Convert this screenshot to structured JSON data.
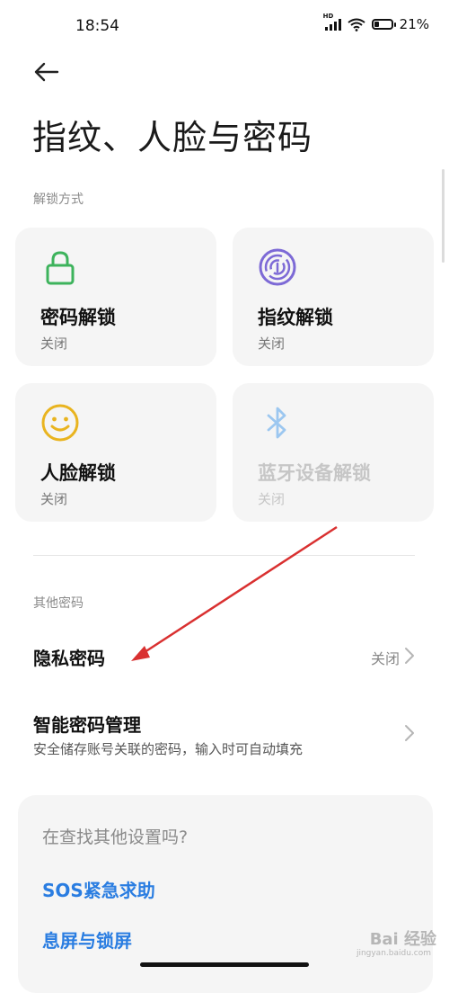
{
  "status_bar": {
    "time": "18:54",
    "network": "HD",
    "battery": "21%"
  },
  "page": {
    "title": "指纹、人脸与密码"
  },
  "unlock_section": {
    "label": "解锁方式",
    "items": [
      {
        "name": "密码解锁",
        "state": "关闭",
        "icon": "lock-icon",
        "color": "#3db35c"
      },
      {
        "name": "指纹解锁",
        "state": "关闭",
        "icon": "fingerprint-icon",
        "color": "#7d6ad6"
      },
      {
        "name": "人脸解锁",
        "state": "关闭",
        "icon": "smiley-face-icon",
        "color": "#e9b41f"
      },
      {
        "name": "蓝牙设备解锁",
        "state": "关闭",
        "icon": "bluetooth-icon",
        "color": "#9cc7f0"
      }
    ]
  },
  "other_section": {
    "label": "其他密码",
    "privacy_password": {
      "label": "隐私密码",
      "value": "关闭"
    },
    "smart_password": {
      "label": "智能密码管理",
      "desc": "安全储存账号关联的密码，输入时可自动填充"
    }
  },
  "suggestions": {
    "question": "在查找其他设置吗?",
    "links": [
      "SOS紧急求助",
      "息屏与锁屏"
    ]
  },
  "watermark": {
    "text": "Bai 经验",
    "sub": "jingyan.baidu.com"
  },
  "colors": {
    "accent": "#2a7de1",
    "annotation_arrow": "#d93030"
  }
}
